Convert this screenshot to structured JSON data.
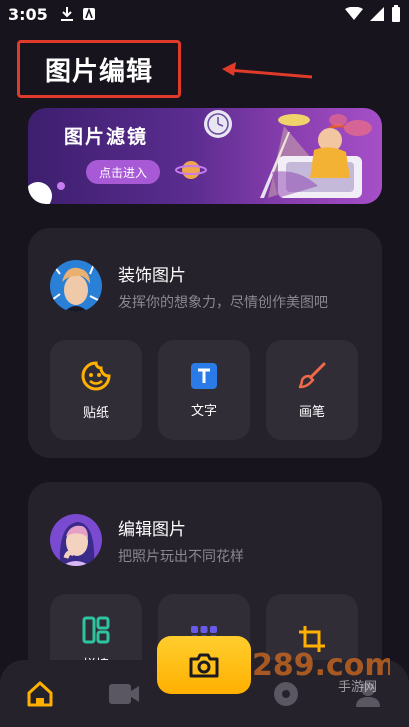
{
  "status": {
    "time": "3:05"
  },
  "header": {
    "title": "图片编辑"
  },
  "banner": {
    "title": "图片滤镜",
    "enter_label": "点击进入"
  },
  "decorate": {
    "title": "装饰图片",
    "subtitle": "发挥你的想象力，尽情创作美图吧",
    "tools": [
      {
        "label": "贴纸",
        "icon": "sticker-icon"
      },
      {
        "label": "文字",
        "icon": "text-icon"
      },
      {
        "label": "画笔",
        "icon": "brush-icon"
      }
    ]
  },
  "edit": {
    "title": "编辑图片",
    "subtitle": "把照片玩出不同花样",
    "tools": [
      {
        "label": "拼接",
        "icon": "collage-icon"
      },
      {
        "label": "",
        "icon": "grid-icon"
      },
      {
        "label": "",
        "icon": "crop-icon"
      }
    ]
  },
  "nav": {
    "items": [
      "home-icon",
      "video-icon",
      "camera-icon",
      "music-icon",
      "profile-icon"
    ]
  },
  "watermark": {
    "text": "289.com",
    "sub": "手游网"
  },
  "colors": {
    "accent": "#ffb000",
    "annotation": "#e03a2a"
  }
}
